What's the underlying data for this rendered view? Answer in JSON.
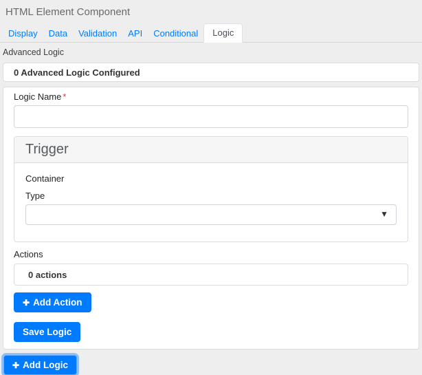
{
  "page": {
    "title": "HTML Element Component"
  },
  "tabs": [
    {
      "label": "Display",
      "active": false
    },
    {
      "label": "Data",
      "active": false
    },
    {
      "label": "Validation",
      "active": false
    },
    {
      "label": "API",
      "active": false
    },
    {
      "label": "Conditional",
      "active": false
    },
    {
      "label": "Logic",
      "active": true
    }
  ],
  "logic_section": {
    "section_label": "Advanced Logic",
    "summary_header": "0 Advanced Logic Configured",
    "form": {
      "logic_name_label": "Logic Name",
      "required_indicator": "*",
      "logic_name_value": "",
      "trigger": {
        "panel_title": "Trigger",
        "container_label": "Container",
        "type_label": "Type",
        "type_selected_value": ""
      },
      "actions_label": "Actions",
      "actions_summary": "0 actions",
      "add_action_label": "Add Action",
      "save_logic_label": "Save Logic"
    },
    "add_logic_label": "Add Logic"
  },
  "icons": {
    "plus": "✚",
    "caret_down": "▼"
  },
  "colors": {
    "primary": "#007bff",
    "page_background": "#eeeeee",
    "panel_border": "#dcdcdc",
    "required_asterisk": "#dc3545",
    "tab_link": "#007bff",
    "title_text": "#666a6e"
  }
}
